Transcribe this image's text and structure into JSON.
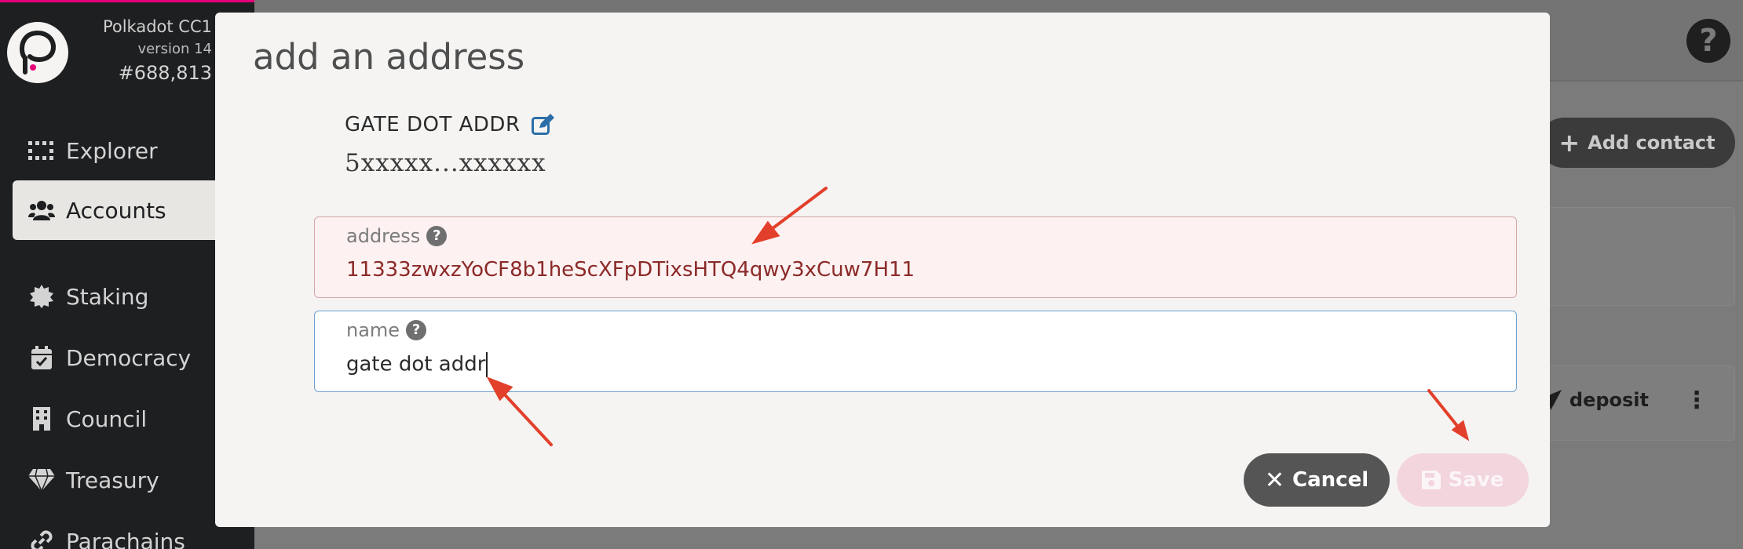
{
  "sidebar": {
    "chain_name": "Polkadot CC1",
    "chain_version": "version 14",
    "chain_block": "#688,813",
    "items": [
      {
        "label": "Explorer",
        "icon": "explorer-grid-icon"
      },
      {
        "label": "Accounts",
        "icon": "users-icon"
      },
      {
        "label": "Staking",
        "icon": "certificate-icon"
      },
      {
        "label": "Democracy",
        "icon": "calendar-check-icon"
      },
      {
        "label": "Council",
        "icon": "building-icon"
      },
      {
        "label": "Treasury",
        "icon": "gem-icon"
      },
      {
        "label": "Parachains",
        "icon": "link-icon"
      }
    ]
  },
  "page": {
    "help_icon": "question-circle-icon",
    "add_contact_label": "Add contact",
    "deposit_label": "deposit"
  },
  "modal": {
    "title": "add an address",
    "account_name": "GATE DOT ADDR",
    "account_address": "5xxxxx...xxxxxx",
    "address_field": {
      "label": "address",
      "value": "11333zwxzYoCF8b1heScXFpDTixsHTQ4qwy3xCuw7H11"
    },
    "name_field": {
      "label": "name",
      "value": "gate dot addr"
    },
    "cancel_label": "Cancel",
    "save_label": "Save"
  },
  "colors": {
    "accent_pink": "#e6007a",
    "error_bg": "#fdf1f1",
    "error_text": "#8b2a28",
    "focus_border": "#6ea0d0",
    "annotation_arrow": "#e2402a"
  }
}
